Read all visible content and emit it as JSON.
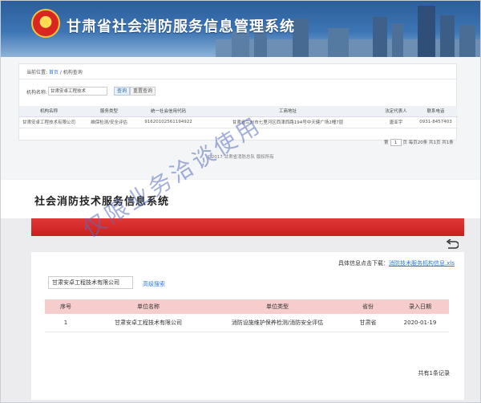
{
  "top": {
    "system_title": "甘肃省社会消防服务信息管理系统",
    "emblem_icon": "fire-department-emblem",
    "breadcrumb": {
      "prefix": "当前位置: ",
      "home": "首页",
      "sep": " / ",
      "current": "机构查询"
    },
    "query": {
      "label": "机构名称:",
      "value": "甘肃安卓工程技术",
      "search_btn": "查询",
      "reset_btn": "重置查询"
    },
    "table": {
      "headers": [
        "机构名称",
        "服务类型",
        "统一社会信用代码",
        "工商地址",
        "法定代表人",
        "联系电话"
      ],
      "rows": [
        [
          "甘肃安卓工程技术有限公司",
          "维保检测/安全评估",
          "91620102561194922",
          "甘肃省兰州市七里河区西津西路194号中天健广场2幢7层",
          "唐亚宇",
          "0931-8457403"
        ]
      ]
    },
    "pager": {
      "first": "第",
      "page": "1",
      "rest": "页 每页20条 共1页 共1条"
    },
    "copyright": "©2017 甘肃省消防总队 版权所有"
  },
  "bottom": {
    "title": "社会消防技术服务信息系统",
    "back_icon": "return-arrow-icon",
    "download_prefix": "具体信息点击下载：",
    "download_link": "消防技术服务机构信息.xls",
    "search_value": "甘肃安卓工程技术有限公司",
    "advanced_search": "高级搜索",
    "table": {
      "headers": [
        "序号",
        "单位名称",
        "单位类型",
        "省份",
        "录入日期"
      ],
      "rows": [
        [
          "1",
          "甘肃安卓工程技术有限公司",
          "消防设施维护保养检测/消防安全评估",
          "甘肃省",
          "2020-01-19"
        ]
      ]
    },
    "total": "共有1条记录"
  },
  "watermark": "仅限业务洽谈使用"
}
